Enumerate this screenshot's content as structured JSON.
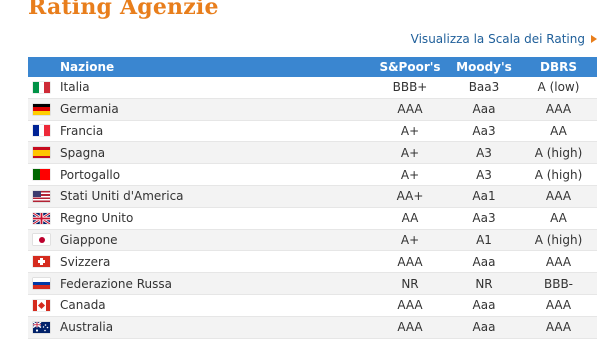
{
  "page": {
    "title": "Rating Agenzie",
    "scale_link": "Visualizza la Scala dei Rating"
  },
  "table": {
    "headers": {
      "country": "Nazione",
      "sp": "S&Poor's",
      "moodys": "Moody's",
      "dbrs": "DBRS"
    },
    "rows": [
      {
        "flag": "italy-flag-icon",
        "country": "Italia",
        "sp": "BBB+",
        "moodys": "Baa3",
        "dbrs": "A (low)"
      },
      {
        "flag": "germany-flag-icon",
        "country": "Germania",
        "sp": "AAA",
        "moodys": "Aaa",
        "dbrs": "AAA"
      },
      {
        "flag": "france-flag-icon",
        "country": "Francia",
        "sp": "A+",
        "moodys": "Aa3",
        "dbrs": "AA"
      },
      {
        "flag": "spain-flag-icon",
        "country": "Spagna",
        "sp": "A+",
        "moodys": "A3",
        "dbrs": "A (high)"
      },
      {
        "flag": "portugal-flag-icon",
        "country": "Portogallo",
        "sp": "A+",
        "moodys": "A3",
        "dbrs": "A (high)"
      },
      {
        "flag": "usa-flag-icon",
        "country": "Stati Uniti d'America",
        "sp": "AA+",
        "moodys": "Aa1",
        "dbrs": "AAA"
      },
      {
        "flag": "uk-flag-icon",
        "country": "Regno Unito",
        "sp": "AA",
        "moodys": "Aa3",
        "dbrs": "AA"
      },
      {
        "flag": "japan-flag-icon",
        "country": "Giappone",
        "sp": "A+",
        "moodys": "A1",
        "dbrs": "A (high)"
      },
      {
        "flag": "switzerland-flag-icon",
        "country": "Svizzera",
        "sp": "AAA",
        "moodys": "Aaa",
        "dbrs": "AAA"
      },
      {
        "flag": "russia-flag-icon",
        "country": "Federazione Russa",
        "sp": "NR",
        "moodys": "NR",
        "dbrs": "BBB-"
      },
      {
        "flag": "canada-flag-icon",
        "country": "Canada",
        "sp": "AAA",
        "moodys": "Aaa",
        "dbrs": "AAA"
      },
      {
        "flag": "australia-flag-icon",
        "country": "Australia",
        "sp": "AAA",
        "moodys": "Aaa",
        "dbrs": "AAA"
      }
    ]
  },
  "colors": {
    "title": "#e87e1c",
    "header_bg": "#3a86d0",
    "link": "#1f5f9a"
  }
}
